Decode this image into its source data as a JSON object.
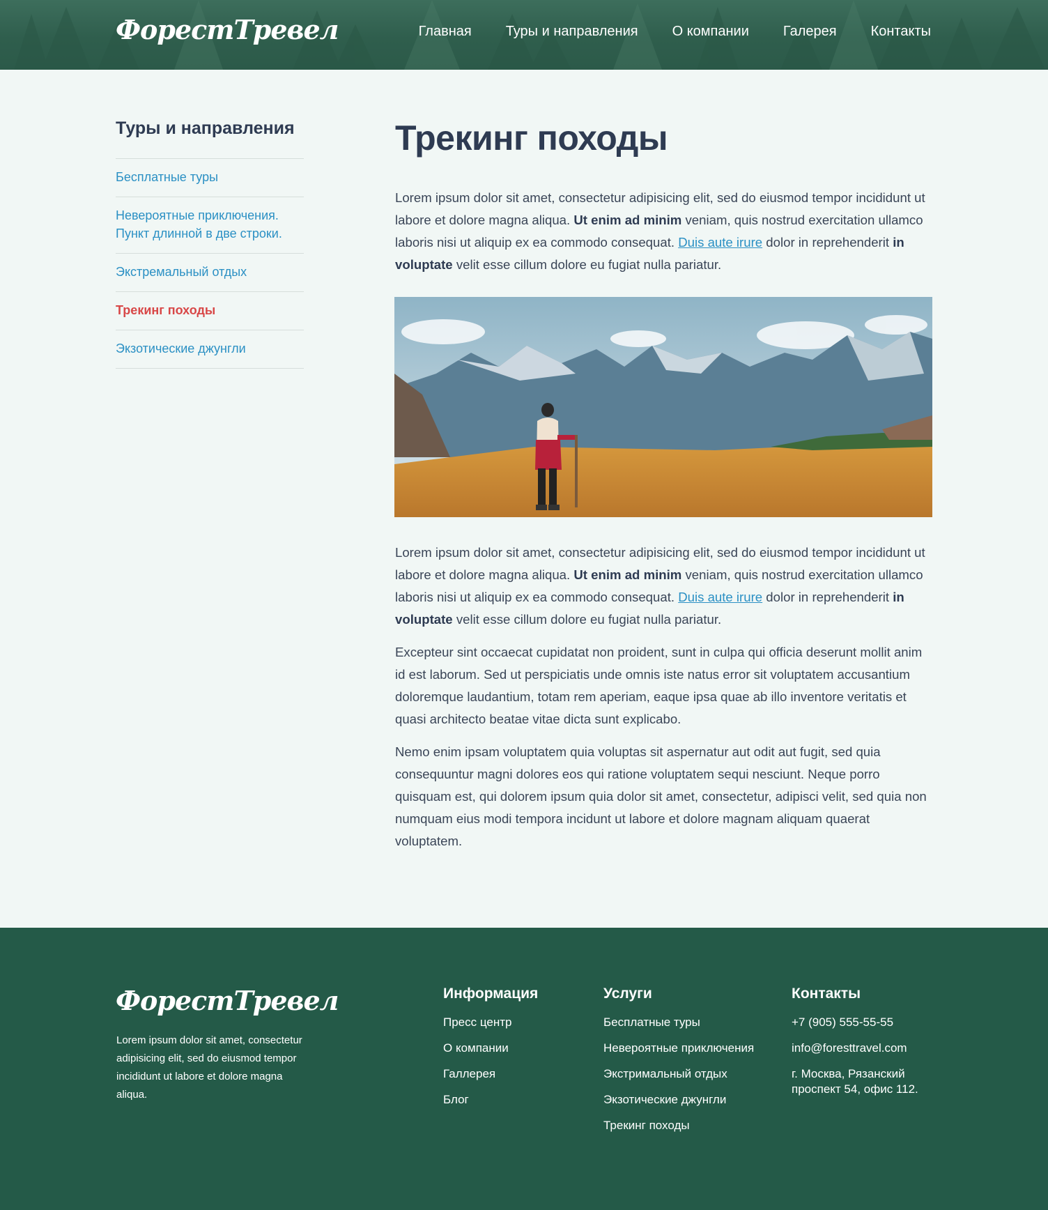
{
  "header": {
    "logo": "ФорестТревел",
    "nav": [
      "Главная",
      "Туры и направления",
      "О компании",
      "Галерея",
      "Контакты"
    ]
  },
  "sidebar": {
    "title": "Туры и направления",
    "items": [
      {
        "label": "Бесплатные туры"
      },
      {
        "label": "Невероятные приключения. Пункт длинной в две строки."
      },
      {
        "label": "Экстремальный отдых"
      },
      {
        "label": "Трекинг походы"
      },
      {
        "label": "Экзотические джунгли"
      }
    ],
    "active_item": "Трекинг походы"
  },
  "main": {
    "title": "Трекинг походы",
    "para1": {
      "t1": "Lorem ipsum dolor sit amet, consectetur adipisicing elit, sed do eiusmod tempor incididunt ut labore et dolore magna aliqua. ",
      "b1": "Ut enim ad minim",
      "t2": " veniam, quis nostrud exercitation ullamco laboris nisi ut aliquip ex ea commodo consequat. ",
      "link": "Duis aute irure",
      "t3": " dolor in reprehenderit ",
      "b2": "in voluptate",
      "t4": " velit esse cillum dolore eu fugiat nulla pariatur."
    },
    "para2": {
      "t1": "Lorem ipsum dolor sit amet, consectetur adipisicing elit, sed do eiusmod tempor incididunt ut labore et dolore magna aliqua. ",
      "b1": "Ut enim ad minim",
      "t2": " veniam, quis nostrud exercitation ullamco laboris nisi ut aliquip ex ea commodo consequat. ",
      "link": "Duis aute irure",
      "t3": " dolor in reprehenderit ",
      "b2": "in voluptate",
      "t4": " velit esse cillum dolore eu fugiat nulla pariatur."
    },
    "para3": "Excepteur sint occaecat cupidatat non proident, sunt in culpa qui officia deserunt mollit anim id est laborum. Sed ut perspiciatis unde omnis iste natus error sit voluptatem accusantium doloremque laudantium, totam rem aperiam, eaque ipsa quae ab illo inventore veritatis et quasi architecto beatae vitae dicta sunt explicabo.",
    "para4": "Nemo enim ipsam voluptatem quia voluptas sit aspernatur aut odit aut fugit, sed quia consequuntur magni dolores eos qui ratione voluptatem sequi nesciunt. Neque porro quisquam est, qui dolorem ipsum quia dolor sit amet, consectetur, adipisci velit, sed quia non numquam eius modi tempora incidunt ut labore et dolore magnam aliquam quaerat voluptatem."
  },
  "footer": {
    "logo": "ФорестТревел",
    "description": "Lorem ipsum dolor sit amet, consectetur adipisicing elit, sed do eiusmod tempor incididunt ut labore et dolore magna aliqua.",
    "info": {
      "title": "Информация",
      "links": [
        "Пресс центр",
        "О компании",
        "Галлерея",
        "Блог"
      ]
    },
    "services": {
      "title": "Услуги",
      "links": [
        "Бесплатные туры",
        "Невероятные приключения",
        "Экстримальный отдых",
        "Экзотические джунгли",
        "Трекинг походы"
      ]
    },
    "contacts": {
      "title": "Контакты",
      "phone": "+7 (905) 555-55-55",
      "email": "info@foresttravel.com",
      "address": "г. Москва, Рязанский проспект 54, офис 112."
    }
  },
  "colors": {
    "header_bg": "#2f5e4d",
    "footer_bg": "#245a48",
    "link": "#2b90c4",
    "active": "#d84848",
    "heading": "#2e3b52",
    "page_bg": "#f1f7f5"
  }
}
